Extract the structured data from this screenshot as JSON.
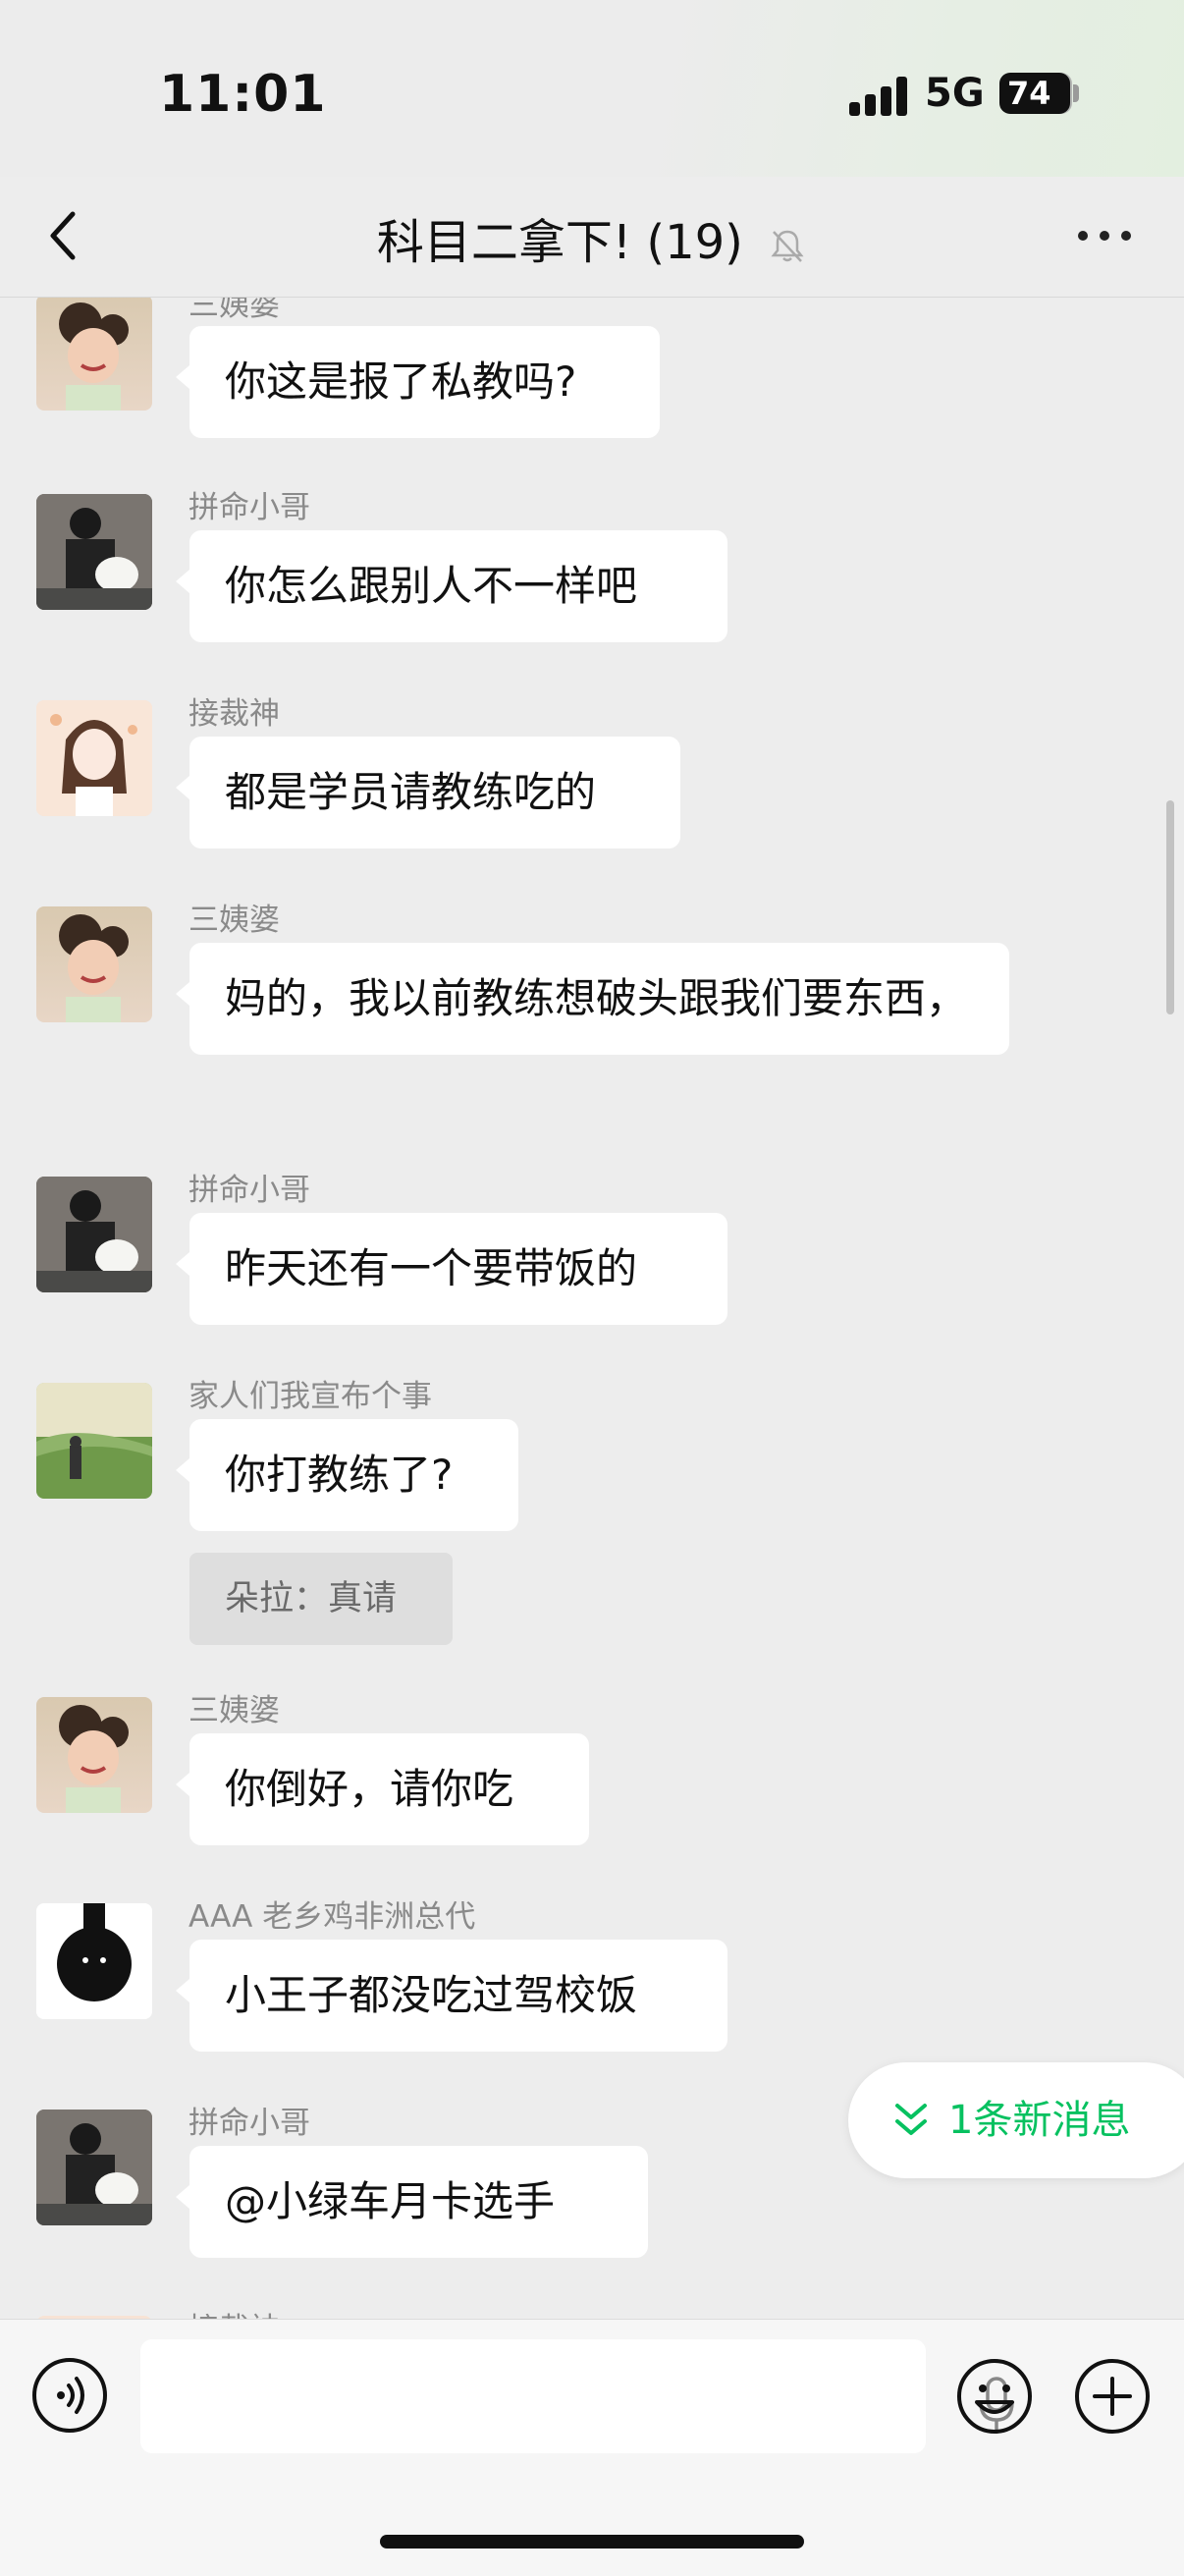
{
  "status_bar": {
    "time": "11:01",
    "network": "5G",
    "battery": "74"
  },
  "header": {
    "title": "科目二拿下! (19)",
    "back_icon": "chevron-left-icon",
    "mute_icon": "bell-slash-icon",
    "more_icon": "more-dots-icon"
  },
  "messages": [
    {
      "name": "三姨婆",
      "text": "你这是报了私教吗?"
    },
    {
      "name": "拼命小哥",
      "text": "你怎么跟别人不一样吧"
    },
    {
      "name": "接裁神",
      "text": "都是学员请教练吃的"
    },
    {
      "name": "三姨婆",
      "text": "妈的，我以前教练想破头跟我们要东西，"
    },
    {
      "name": "拼命小哥",
      "text": "昨天还有一个要带饭的"
    },
    {
      "name": "家人们我宣布个事",
      "text": "你打教练了?",
      "quote": "朵拉：真请"
    },
    {
      "name": "三姨婆",
      "text": "你倒好，请你吃"
    },
    {
      "name": "AAA 老乡鸡非洲总代",
      "text": "小王子都没吃过驾校饭"
    },
    {
      "name": "拼命小哥",
      "text": "@小绿车月卡选手"
    },
    {
      "name": "接裁神",
      "text": ""
    }
  ],
  "new_message_pill": {
    "label": "1条新消息",
    "color": "#07c160"
  },
  "input_bar": {
    "voice_icon": "voice-icon",
    "mic_icon": "mic-icon",
    "emoji_icon": "emoji-icon",
    "plus_icon": "plus-icon",
    "value": ""
  }
}
